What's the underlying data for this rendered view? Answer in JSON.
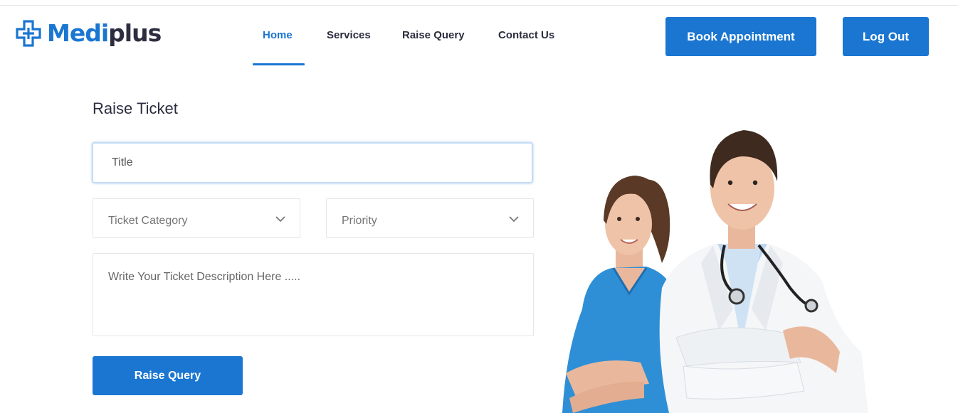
{
  "brand": {
    "part1": "Medi",
    "part2": "plus",
    "color": "#1a76d1"
  },
  "nav": {
    "items": [
      {
        "label": "Home",
        "active": true
      },
      {
        "label": "Services",
        "active": false
      },
      {
        "label": "Raise Query",
        "active": false
      },
      {
        "label": "Contact Us",
        "active": false
      }
    ]
  },
  "header": {
    "book_label": "Book Appointment",
    "logout_label": "Log Out"
  },
  "form": {
    "heading": "Raise Ticket",
    "title_placeholder": "Title",
    "title_value": "",
    "category_placeholder": "Ticket Category",
    "priority_placeholder": "Priority",
    "description_placeholder": "Write Your Ticket Description Here .....",
    "description_value": "",
    "submit_label": "Raise Query"
  },
  "icons": {
    "logo": "medical-cross-icon",
    "dropdown": "chevron-down-icon"
  },
  "colors": {
    "primary": "#1a76d1",
    "text": "#2c2d3f"
  }
}
